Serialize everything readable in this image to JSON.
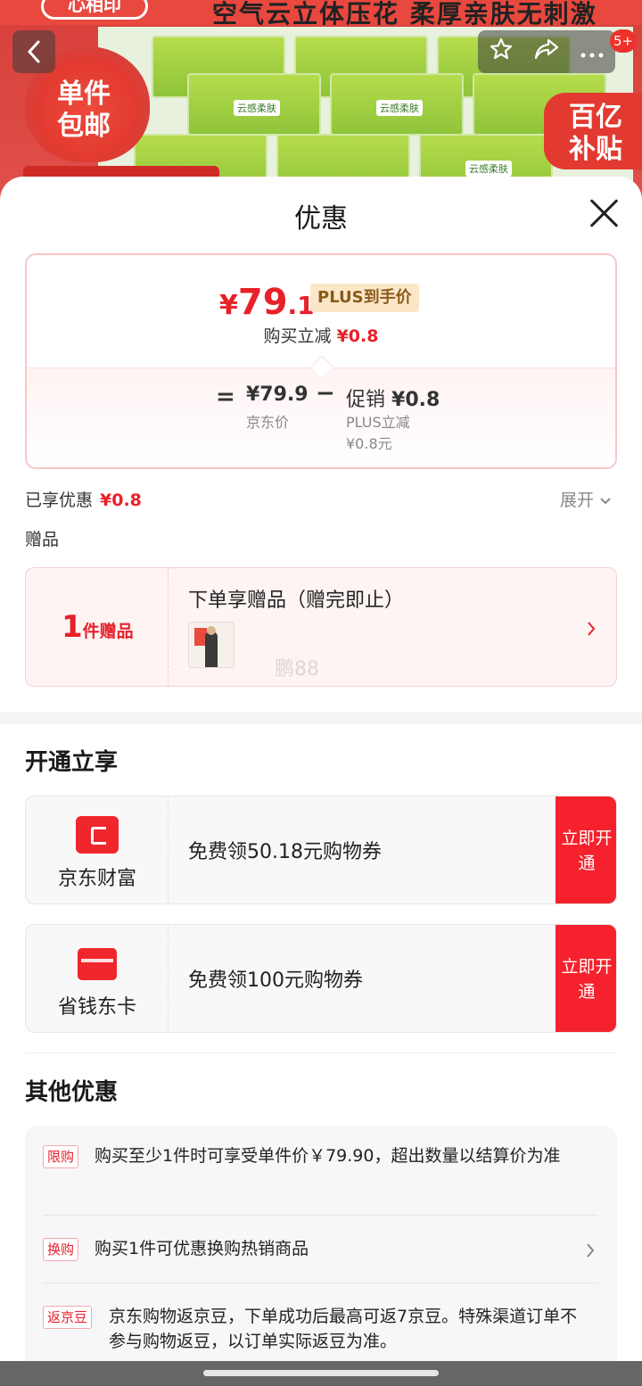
{
  "banner": {
    "slogan": "空气云立体压花   柔厚亲肤无刺激",
    "brand": "心相印",
    "flame_text": "单件包邮",
    "subsidy_text": "百亿补贴",
    "pack_label": "云感柔肤",
    "badge_count": "5+"
  },
  "nav": {
    "back_icon": "chevron-left-icon",
    "favorite_icon": "star-icon",
    "share_icon": "share-icon",
    "more_icon": "more-icon"
  },
  "sheet": {
    "title": "优惠",
    "price": {
      "currency": "¥",
      "integer": "79",
      "decimal": ".1",
      "plus_tag": "PLUS到手价",
      "reduce_label": "购买立减",
      "reduce_value": "¥0.8"
    },
    "breakdown": {
      "equals": "=",
      "jd_price": "¥79.9",
      "jd_label": "京东价",
      "minus": "−",
      "promo_label": "促销",
      "promo_value": "¥0.8",
      "plus_reduce_label": "PLUS立减",
      "plus_reduce_value": "¥0.8元"
    },
    "enjoyed_label": "已享优惠",
    "enjoyed_value": "¥0.8",
    "expand_label": "展开",
    "gift_section_label": "赠品",
    "gift": {
      "count": "1",
      "unit": "件赠品",
      "desc": "下单享赠品（赠完即止）",
      "watermark": "鹏88"
    },
    "open_section_title": "开通立享",
    "open_cards": [
      {
        "label": "京东财富",
        "desc": "免费领50.18元购物券",
        "cta": "立即开通"
      },
      {
        "label": "省钱东卡",
        "desc": "免费领100元购物券",
        "cta": "立即开通"
      }
    ],
    "other_section_title": "其他优惠",
    "other_rows": [
      {
        "tag": "限购",
        "text": "购买至少1件时可享受单件价￥79.90，超出数量以结算价为准"
      },
      {
        "tag": "换购",
        "text": "购买1件可优惠换购热销商品"
      },
      {
        "tag": "返京豆",
        "text": "京东购物返京豆，下单成功后最高可返7京豆。特殊渠道订单不参与购物返豆，以订单实际返豆为准。"
      }
    ]
  }
}
